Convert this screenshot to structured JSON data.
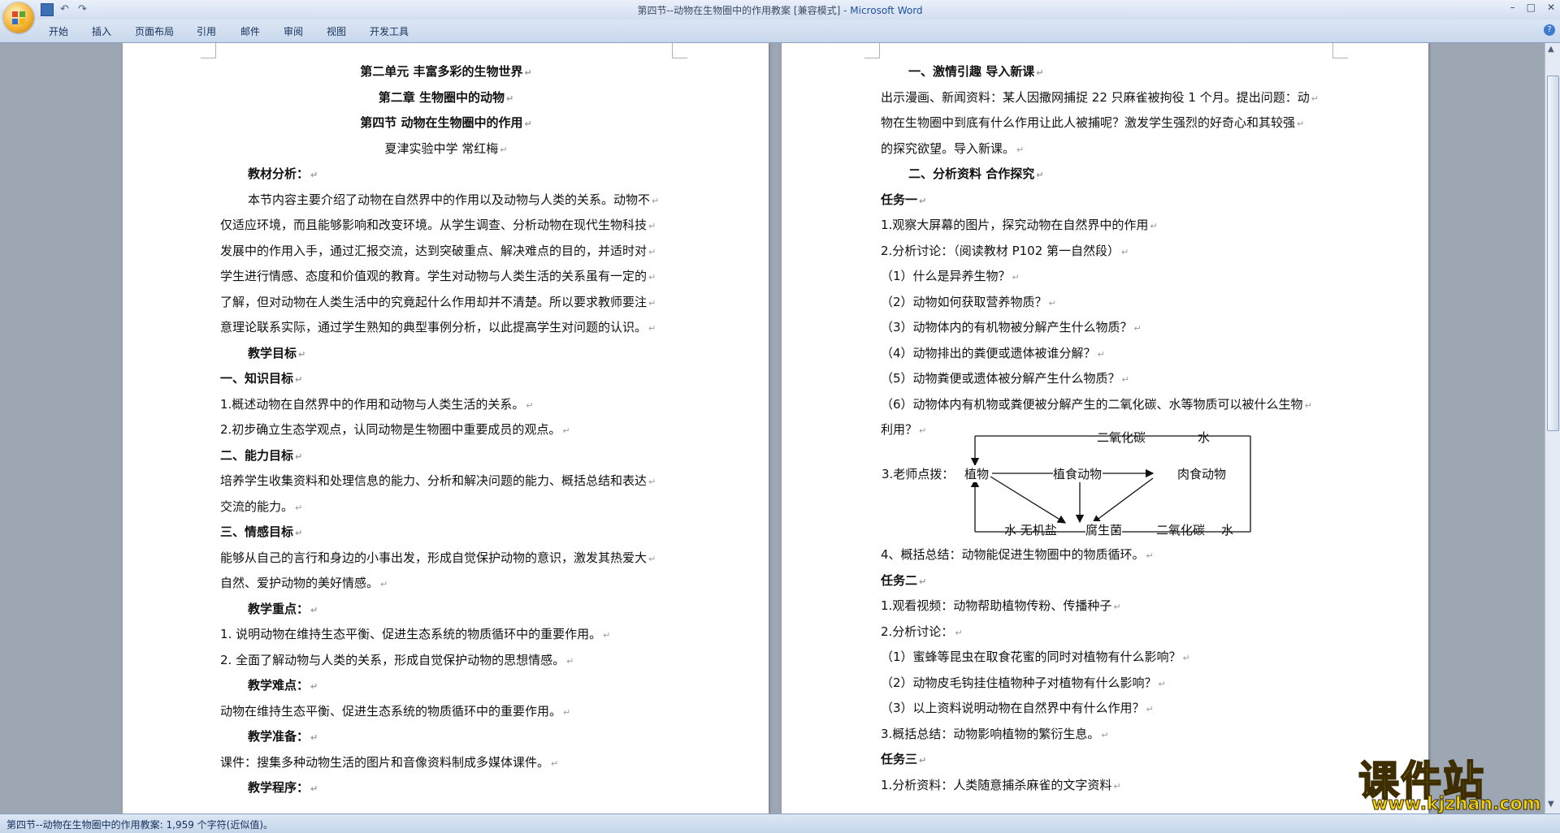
{
  "window": {
    "title_doc": "第四节--动物在生物圈中的作用教案 [兼容模式] - ",
    "title_app": "Microsoft Word",
    "minimize_glyph": "–",
    "maximize_glyph": "□",
    "close_glyph": "✕"
  },
  "ribbon": {
    "tabs": [
      "开始",
      "插入",
      "页面布局",
      "引用",
      "邮件",
      "审阅",
      "视图",
      "开发工具"
    ],
    "help_glyph": "?"
  },
  "page1": {
    "lines": [
      {
        "text": "第二单元    丰富多彩的生物世界",
        "style": "center b"
      },
      {
        "text": "第二章    生物圈中的动物",
        "style": "center b"
      },
      {
        "text": "第四节    动物在生物圈中的作用",
        "style": "center b"
      },
      {
        "text": "夏津实验中学      常红梅",
        "style": "center"
      },
      {
        "text": "教材分析：",
        "style": "b ind"
      },
      {
        "text": "本节内容主要介绍了动物在自然界中的作用以及动物与人类的关系。动物不",
        "style": "ind"
      },
      {
        "text": "仅适应环境，而且能够影响和改变环境。从学生调查、分析动物在现代生物科技",
        "style": ""
      },
      {
        "text": "发展中的作用入手，通过汇报交流，达到突破重点、解决难点的目的，并适时对",
        "style": ""
      },
      {
        "text": "学生进行情感、态度和价值观的教育。学生对动物与人类生活的关系虽有一定的",
        "style": ""
      },
      {
        "text": "了解，但对动物在人类生活中的究竟起什么作用却并不清楚。所以要求教师要注",
        "style": ""
      },
      {
        "text": "意理论联系实际，通过学生熟知的典型事例分析，以此提高学生对问题的认识。",
        "style": ""
      },
      {
        "text": "教学目标",
        "style": "b ind"
      },
      {
        "text": "一、知识目标",
        "style": "b"
      },
      {
        "text": "1.概述动物在自然界中的作用和动物与人类生活的关系。",
        "style": ""
      },
      {
        "text": "2.初步确立生态学观点，认同动物是生物圈中重要成员的观点。",
        "style": ""
      },
      {
        "text": "二、能力目标",
        "style": "b"
      },
      {
        "text": "培养学生收集资料和处理信息的能力、分析和解决问题的能力、概括总结和表达",
        "style": ""
      },
      {
        "text": "交流的能力。",
        "style": ""
      },
      {
        "text": "三、情感目标",
        "style": "b"
      },
      {
        "text": "能够从自己的言行和身边的小事出发，形成自觉保护动物的意识，激发其热爱大",
        "style": ""
      },
      {
        "text": "自然、爱护动物的美好情感。",
        "style": ""
      },
      {
        "text": "教学重点：",
        "style": "b ind"
      },
      {
        "text": "1. 说明动物在维持生态平衡、促进生态系统的物质循环中的重要作用。",
        "style": ""
      },
      {
        "text": "2. 全面了解动物与人类的关系，形成自觉保护动物的思想情感。",
        "style": ""
      },
      {
        "text": "教学难点：",
        "style": "b ind"
      },
      {
        "text": "动物在维持生态平衡、促进生态系统的物质循环中的重要作用。",
        "style": ""
      },
      {
        "text": "教学准备：",
        "style": "b ind"
      },
      {
        "text": "课件：搜集多种动物生活的图片和音像资料制成多媒体课件。",
        "style": ""
      },
      {
        "text": "教学程序：",
        "style": "b ind"
      }
    ]
  },
  "page2": {
    "lines_before": [
      {
        "text": "一、激情引趣 导入新课",
        "style": "b ind"
      },
      {
        "text": "出示漫画、新闻资料：某人因撒网捕捉 22 只麻雀被拘役 1 个月。提出问题：动",
        "style": ""
      },
      {
        "text": "物在生物圈中到底有什么作用让此人被捕呢？激发学生强烈的好奇心和其较强",
        "style": ""
      },
      {
        "text": "的探究欲望。导入新课。",
        "style": ""
      },
      {
        "text": "二、分析资料 合作探究",
        "style": "b ind"
      },
      {
        "text": "任务一",
        "style": "b"
      },
      {
        "text": "1.观察大屏幕的图片，探究动物在自然界中的作用",
        "style": ""
      },
      {
        "text": "2.分析讨论：（阅读教材 P102 第一自然段）",
        "style": ""
      },
      {
        "text": "（1）什么是异养生物？",
        "style": ""
      },
      {
        "text": "（2）动物如何获取营养物质？",
        "style": ""
      },
      {
        "text": "（3）动物体内的有机物被分解产生什么物质？",
        "style": ""
      },
      {
        "text": "（4）动物排出的粪便或遗体被谁分解？",
        "style": ""
      },
      {
        "text": "（5）动物粪便或遗体被分解产生什么物质？",
        "style": ""
      },
      {
        "text": "（6）动物体内有机物或粪便被分解产生的二氧化碳、水等物质可以被什么生物",
        "style": ""
      },
      {
        "text": "利用？",
        "style": ""
      }
    ],
    "diagram": {
      "label_teacher": "3.老师点拨：",
      "plant": "植物",
      "herbivore": "植食动物",
      "carnivore": "肉食动物",
      "decomposer": "腐生菌",
      "co2_top": "二氧化碳",
      "water_top": "水",
      "bottom_left": "水  无机盐",
      "co2_bottom": "二氧化碳",
      "water_bottom": "水"
    },
    "lines_after": [
      {
        "text": "4、概括总结：动物能促进生物圈中的物质循环。",
        "style": ""
      },
      {
        "text": "任务二",
        "style": "b"
      },
      {
        "text": "1.观看视频：动物帮助植物传粉、传播种子",
        "style": ""
      },
      {
        "text": "2.分析讨论：",
        "style": ""
      },
      {
        "text": "（1）蜜蜂等昆虫在取食花蜜的同时对植物有什么影响？",
        "style": ""
      },
      {
        "text": "（2）动物皮毛钩挂住植物种子对植物有什么影响？",
        "style": ""
      },
      {
        "text": "（3）以上资料说明动物在自然界中有什么作用？",
        "style": ""
      },
      {
        "text": "3.概括总结：动物影响植物的繁衍生息。",
        "style": ""
      },
      {
        "text": "任务三",
        "style": "b"
      },
      {
        "text": "1.分析资料：人类随意捕杀麻雀的文字资料",
        "style": ""
      }
    ]
  },
  "statusbar": {
    "text": "第四节--动物在生物圈中的作用教案: 1,959 个字符(近似值)。"
  },
  "watermark": {
    "title": "课件站",
    "url": "www.kjzhan.com"
  },
  "colors": {
    "workspace_bg": "#9da6b3",
    "ribbon_bg": "#dbe6f4",
    "watermark_fill": "#f2d30a"
  }
}
